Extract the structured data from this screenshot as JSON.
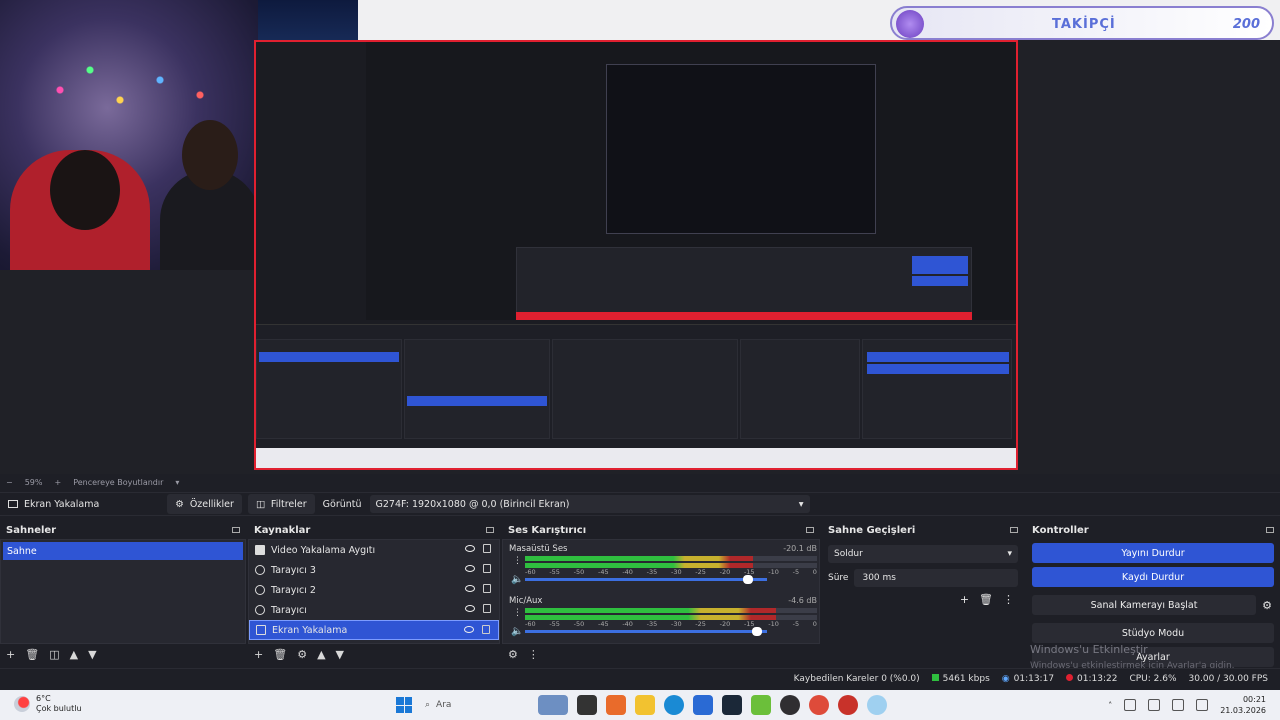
{
  "overlay": {
    "follower_label": "TAKİPÇİ",
    "follower_count": "200"
  },
  "zoom": {
    "level": "59%",
    "mode": "Pencereye Boyutlandır"
  },
  "source_toolbar": {
    "source_name": "Ekran Yakalama",
    "properties": "Özellikler",
    "filters": "Filtreler",
    "display_label": "Görüntü",
    "display_value": "G274F: 1920x1080 @ 0,0 (Birincil Ekran)"
  },
  "scenes": {
    "title": "Sahneler",
    "items": [
      "Sahne"
    ]
  },
  "sources": {
    "title": "Kaynaklar",
    "items": [
      {
        "label": "Video Yakalama Aygıtı",
        "icon": "camera-icon"
      },
      {
        "label": "Tarayıcı 3",
        "icon": "globe-icon"
      },
      {
        "label": "Tarayıcı 2",
        "icon": "globe-icon"
      },
      {
        "label": "Tarayıcı",
        "icon": "globe-icon"
      },
      {
        "label": "Ekran Yakalama",
        "icon": "monitor-icon"
      }
    ]
  },
  "mixer": {
    "title": "Ses Karıştırıcı",
    "channels": [
      {
        "name": "Masaüstü Ses",
        "db": "-20.1 dB",
        "level": 0.78,
        "volume": 0.92
      },
      {
        "name": "Mic/Aux",
        "db": "-4.6 dB",
        "level": 0.86,
        "volume": 0.96
      }
    ],
    "ticks": [
      "-60",
      "-55",
      "-50",
      "-45",
      "-40",
      "-35",
      "-30",
      "-25",
      "-20",
      "-15",
      "-10",
      "-5",
      "0"
    ]
  },
  "transitions": {
    "title": "Sahne Geçişleri",
    "type": "Soldur",
    "duration_label": "Süre",
    "duration": "300 ms"
  },
  "controls": {
    "title": "Kontroller",
    "stop_stream": "Yayını Durdur",
    "stop_record": "Kaydı Durdur",
    "virtual_cam": "Sanal Kamerayı Başlat",
    "studio_mode": "Stüdyo Modu",
    "settings": "Ayarlar"
  },
  "watermark": {
    "title": "Windows'u Etkinleştir",
    "subtitle": "Windows'u etkinleştirmek için Ayarlar'a gidin."
  },
  "status": {
    "dropped": "Kaybedilen Kareler 0 (%0.0)",
    "bitrate": "5461 kbps",
    "stream_time": "01:13:17",
    "rec_time": "01:13:22",
    "cpu": "CPU: 2.6%",
    "fps": "30.00 / 30.00 FPS"
  },
  "taskbar": {
    "temp": "6°C",
    "weather": "Çok bulutlu",
    "search": "Ara",
    "time": "00:21",
    "date": "21.03.2026"
  },
  "colors": {
    "accent": "#2f55d4",
    "record": "#e02030",
    "panel": "#272830"
  }
}
